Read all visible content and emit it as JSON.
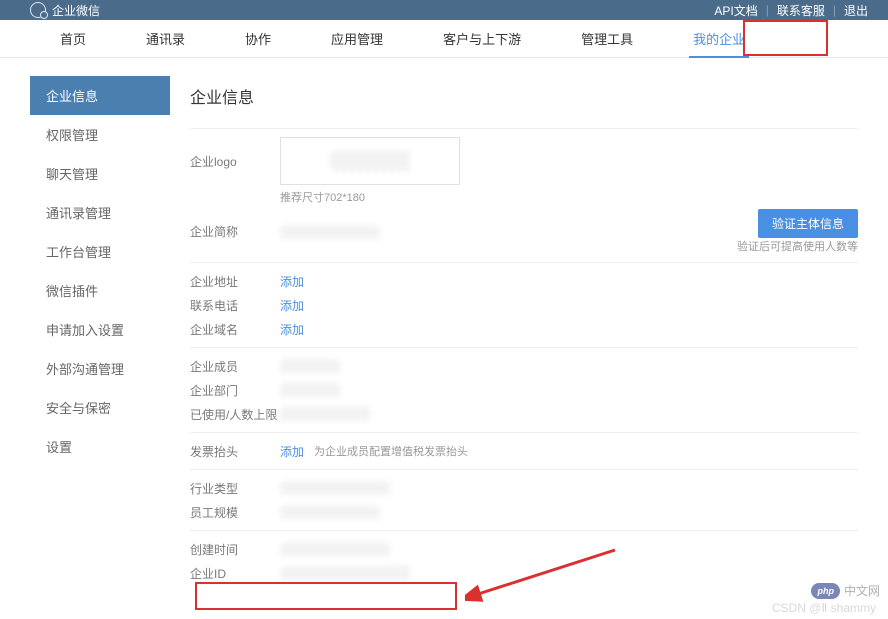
{
  "topbar": {
    "brand": "企业微信",
    "links": {
      "api": "API文档",
      "contact": "联系客服",
      "logout": "退出"
    }
  },
  "nav": {
    "items": [
      "首页",
      "通讯录",
      "协作",
      "应用管理",
      "客户与上下游",
      "管理工具",
      "我的企业"
    ],
    "active_index": 6
  },
  "sidebar": {
    "items": [
      "企业信息",
      "权限管理",
      "聊天管理",
      "通讯录管理",
      "工作台管理",
      "微信插件",
      "申请加入设置",
      "外部沟通管理",
      "安全与保密",
      "设置"
    ],
    "active_index": 0
  },
  "page": {
    "title": "企业信息",
    "logo": {
      "label": "企业logo",
      "hint": "推荐尺寸702*180"
    },
    "name_row": {
      "label": "企业简称",
      "verify_btn": "验证主体信息",
      "verify_hint": "验证后可提高使用人数等"
    },
    "address": {
      "label": "企业地址",
      "action": "添加"
    },
    "phone": {
      "label": "联系电话",
      "action": "添加"
    },
    "domain": {
      "label": "企业域名",
      "action": "添加"
    },
    "members": {
      "label": "企业成员"
    },
    "depts": {
      "label": "企业部门"
    },
    "used": {
      "label": "已使用/人数上限"
    },
    "invoice": {
      "label": "发票抬头",
      "action": "添加",
      "hint": "为企业成员配置增值税发票抬头"
    },
    "industry": {
      "label": "行业类型"
    },
    "scale": {
      "label": "员工规模"
    },
    "created": {
      "label": "创建时间"
    },
    "corp_id": {
      "label": "企业ID"
    }
  },
  "watermark": {
    "phpcn": "中文网",
    "csdn": "CSDN @Ⅱ shammy"
  }
}
